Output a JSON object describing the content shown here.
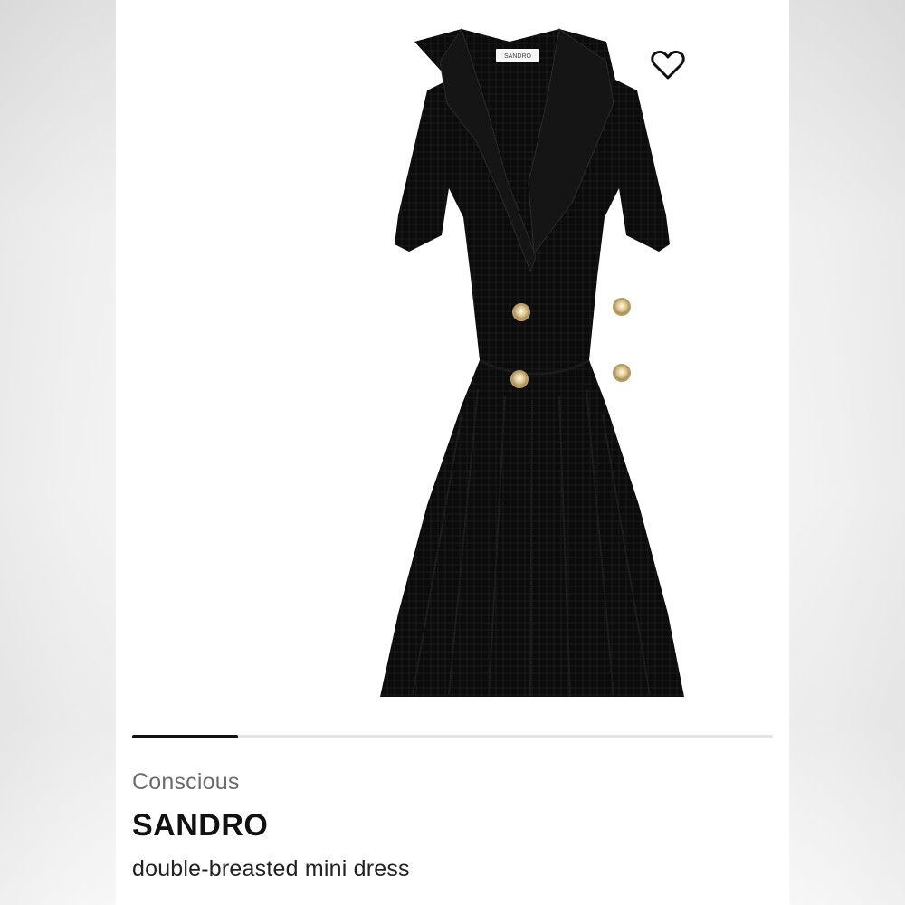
{
  "product": {
    "tag": "Conscious",
    "brand": "SANDRO",
    "name": "double-breasted mini dress",
    "image_icon": "black-tweed-dress-image",
    "label_text": "SANDRO"
  },
  "gallery": {
    "progress": 0.165
  },
  "wishlist": {
    "icon": "heart-outline-icon"
  },
  "colors": {
    "dress": "#0d0d0d",
    "buttons": "#d8c28d",
    "accent": "#111111",
    "track": "#e4e4e4"
  }
}
